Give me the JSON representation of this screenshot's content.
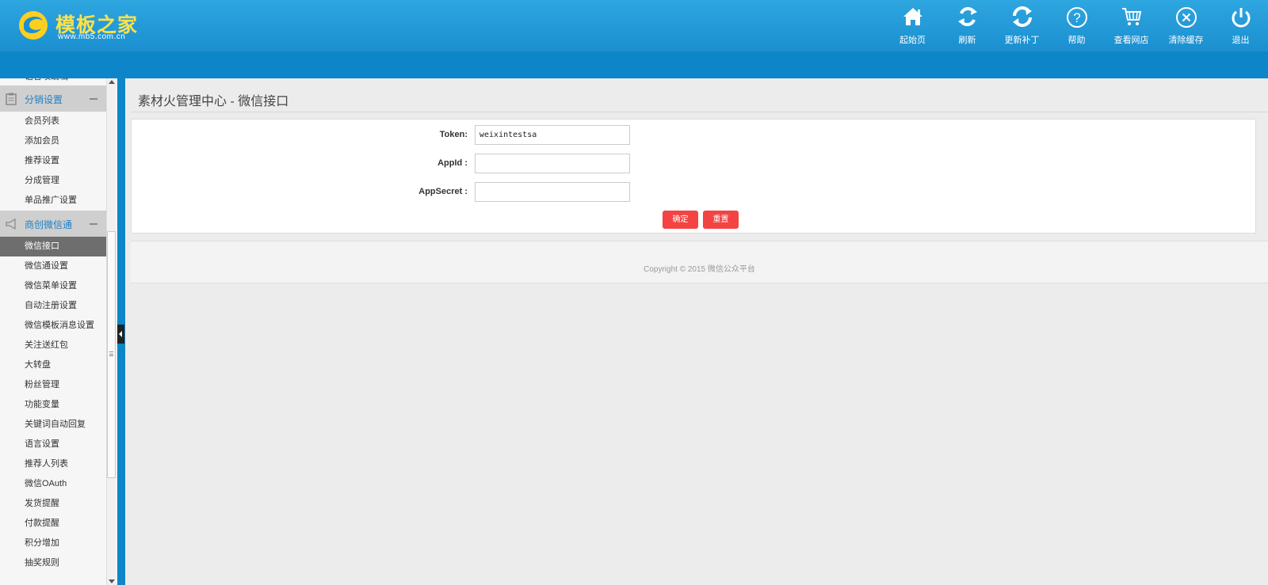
{
  "brand": {
    "title": "模板之家",
    "url": "www.mb5.com.cn",
    "accent_color": "#ffe14a"
  },
  "topnav": [
    {
      "label": "起始页",
      "icon": "home-icon"
    },
    {
      "label": "刷新",
      "icon": "refresh-arrows-icon"
    },
    {
      "label": "更新补丁",
      "icon": "update-icon"
    },
    {
      "label": "帮助",
      "icon": "help-icon"
    },
    {
      "label": "查看网店",
      "icon": "cart-icon"
    },
    {
      "label": "清除缓存",
      "icon": "clear-cache-icon"
    },
    {
      "label": "退出",
      "icon": "power-icon"
    }
  ],
  "sidebar": {
    "clipped_item": "语言项编辑",
    "group1": {
      "label": "分销设置",
      "icon": "clipboard-icon"
    },
    "group1_items": [
      "会员列表",
      "添加会员",
      "推荐设置",
      "分成管理",
      "单品推广设置"
    ],
    "group2": {
      "label": "商创微信通",
      "icon": "speaker-icon"
    },
    "group2_items": [
      "微信接口",
      "微信通设置",
      "微信菜单设置",
      "自动注册设置",
      "微信模板消息设置",
      "关注送红包",
      "大转盘",
      "粉丝管理",
      "功能变量",
      "关键词自动回复",
      "语言设置",
      "推荐人列表",
      "微信OAuth",
      "发货提醒",
      "付款提醒",
      "积分增加",
      "抽奖规则"
    ],
    "active_item": "微信接口"
  },
  "main": {
    "title": "素材火管理中心 - 微信接口",
    "form": {
      "token_label": "Token:",
      "token_value": "weixintestsa",
      "appid_label": "AppId :",
      "appid_value": "",
      "appsecret_label": "AppSecret :",
      "appsecret_value": "",
      "submit_label": "确定",
      "reset_label": "重置"
    },
    "footer": "Copyright © 2015 微信公众平台"
  },
  "colors": {
    "header": "#1b8fd0",
    "subbar": "#0c86c8",
    "button": "#f44343",
    "active_item": "#6e6e6e"
  }
}
